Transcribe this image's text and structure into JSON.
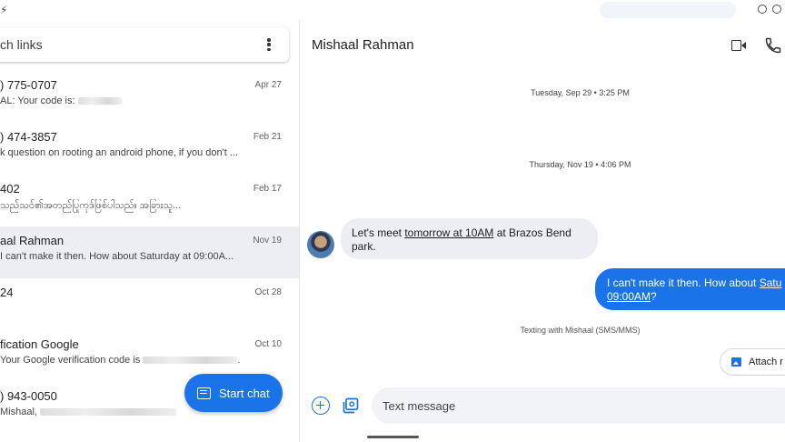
{
  "search": {
    "placeholder": "ch links"
  },
  "conversations": [
    {
      "name": ") 775-0707",
      "snippet": "AL: Your code is:",
      "date": "Apr 27"
    },
    {
      "name": ") 474-3857",
      "snippet": "k question on rooting an android phone, if you don't ...",
      "date": "Feb 21"
    },
    {
      "name": "402",
      "snippet": "သည်သင်၏အတည်ပြုကုဒ်ဖြစ်ပါသည်။ အခြားသူ...",
      "date": "Feb 17"
    },
    {
      "name": "aal Rahman",
      "snippet": "I can't make it then. How about Saturday at 09:00A...",
      "date": "Nov 19"
    },
    {
      "name": "24",
      "snippet": "",
      "date": "Oct 28"
    },
    {
      "name": "fication Google",
      "snippet": "Your Google verification code is",
      "snippet_end": ".",
      "date": "Oct 10"
    },
    {
      "name": ") 943-0050",
      "snippet": "Mishaal,",
      "date": ""
    }
  ],
  "fab": {
    "label": "Start chat",
    "icon": "chat-icon"
  },
  "thread": {
    "title": "Mishaal Rahman",
    "timestamps": [
      "Tuesday, Sep 29 • 3:25 PM",
      "Thursday, Nov 19 • 4:06 PM"
    ],
    "incoming": {
      "before": "Let's meet ",
      "link": "tomorrow at 10AM",
      "after": " at Brazos Bend park."
    },
    "outgoing": {
      "before": "I can't make it then. How about ",
      "link1": "Satu",
      "link2": "09:00AM",
      "after": "?"
    },
    "texting_note": "Texting with Mishaal (SMS/MMS)",
    "attach_label": "Attach r",
    "input_placeholder": "Text message"
  },
  "colors": {
    "accent": "#1a73e8",
    "selected_row": "#eceef3",
    "bubble_incoming": "#eceef3"
  }
}
